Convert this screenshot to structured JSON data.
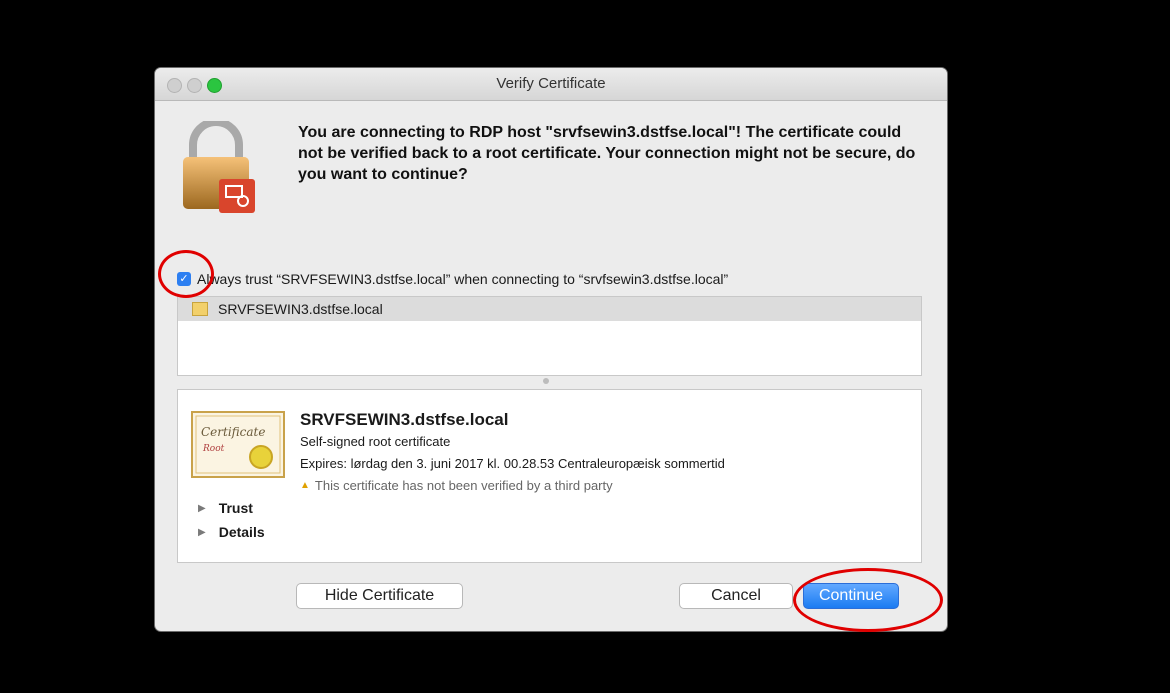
{
  "window": {
    "title": "Verify Certificate"
  },
  "message": "You are connecting to RDP host \"srvfsewin3.dstfse.local\"! The certificate could not be verified back to a root certificate. Your connection might not be secure, do you want to continue?",
  "trust_checkbox": {
    "checked": true,
    "label": "Always trust “SRVFSEWIN3.dstfse.local” when connecting to “srvfsewin3.dstfse.local”"
  },
  "certificate_list": {
    "items": [
      "SRVFSEWIN3.dstfse.local"
    ]
  },
  "certificate_details": {
    "name": "SRVFSEWIN3.dstfse.local",
    "type": "Self-signed root certificate",
    "expires": "Expires: lørdag den 3. juni 2017 kl. 00.28.53 Centraleuropæisk sommertid",
    "warning": "This certificate has not been verified by a third party",
    "sections": [
      "Trust",
      "Details"
    ],
    "image_text_1": "Certificate",
    "image_text_2": "Root"
  },
  "buttons": {
    "hide_certificate": "Hide Certificate",
    "cancel": "Cancel",
    "continue": "Continue"
  },
  "colors": {
    "accent": "#2d7ff1",
    "annotation": "#e00000",
    "lock_body": "#f0a030",
    "lock_badge": "#d9452c"
  },
  "icons": [
    "lock-icon",
    "remote-desktop-icon",
    "certificate-icon",
    "warning-icon",
    "disclosure-triangle-icon"
  ]
}
